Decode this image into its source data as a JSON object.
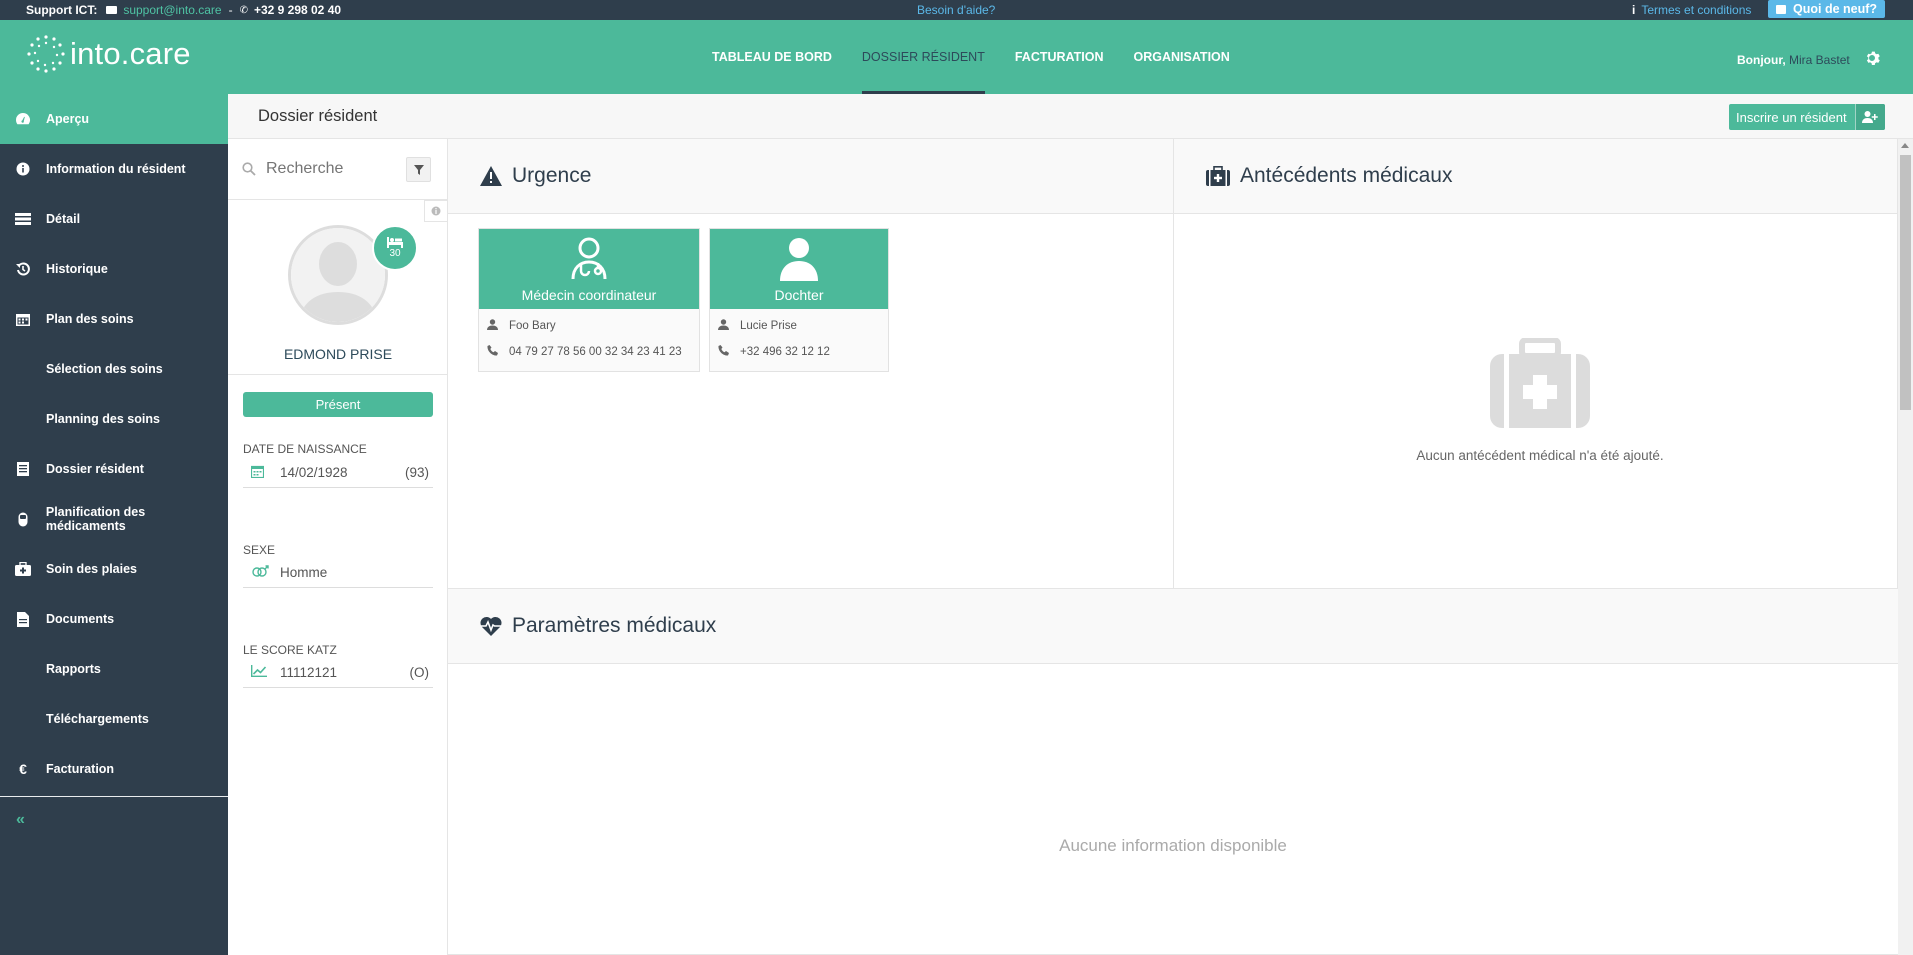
{
  "support": {
    "label": "Support ICT:",
    "email": "support@into.care",
    "sep": "-",
    "phone": "+32 9 298 02 40",
    "help": "Besoin d'aide?",
    "terms": "Termes et conditions",
    "news": "Quoi de neuf?"
  },
  "header": {
    "logo": "into.care",
    "nav": [
      "TABLEAU DE BORD",
      "DOSSIER RÉSIDENT",
      "FACTURATION",
      "ORGANISATION"
    ],
    "greeting": "Bonjour,",
    "user": "Mira Bastet"
  },
  "sidebar": {
    "items": [
      {
        "label": "Aperçu",
        "icon": "dashboard-icon"
      },
      {
        "label": "Information du résident",
        "icon": "info-icon"
      },
      {
        "label": "Détail",
        "icon": "detail-icon"
      },
      {
        "label": "Historique",
        "icon": "history-icon"
      },
      {
        "label": "Plan des soins",
        "icon": "calendar-icon"
      },
      {
        "label": "Sélection des soins"
      },
      {
        "label": "Planning des soins"
      },
      {
        "label": "Dossier résident",
        "icon": "file-list-icon"
      },
      {
        "label": "Planification des médicaments",
        "icon": "pill-icon"
      },
      {
        "label": "Soin des plaies",
        "icon": "medkit-icon"
      },
      {
        "label": "Documents",
        "icon": "document-icon"
      },
      {
        "label": "Rapports"
      },
      {
        "label": "Téléchargements"
      },
      {
        "label": "Facturation",
        "icon": "euro-icon"
      }
    ],
    "collapse": "«"
  },
  "page": {
    "title": "Dossier résident",
    "enroll": "Inscrire un résident"
  },
  "resident": {
    "search_placeholder": "Recherche",
    "room": "30",
    "name": "EDMOND PRISE",
    "status": "Présent",
    "dob_label": "DATE DE NAISSANCE",
    "dob": "14/02/1928",
    "age": "(93)",
    "sex_label": "SEXE",
    "sex": "Homme",
    "katz_label": "LE SCORE KATZ",
    "katz": "11112121",
    "katz_cat": "(O)"
  },
  "urgence": {
    "title": "Urgence",
    "cards": [
      {
        "role": "Médecin coordinateur",
        "name": "Foo Bary",
        "phone": "04 79 27 78 56 00 32 34 23 41 23"
      },
      {
        "role": "Dochter",
        "name": "Lucie Prise",
        "phone": "+32 496 32 12 12"
      }
    ]
  },
  "antecedents": {
    "title": "Antécédents médicaux",
    "empty": "Aucun antécédent médical n'a été ajouté."
  },
  "parametres": {
    "title": "Paramètres médicaux",
    "empty": "Aucune information disponible"
  },
  "colors": {
    "brand": "#4cb99a",
    "dark": "#2f3e4c",
    "link": "#5bb8e8"
  }
}
